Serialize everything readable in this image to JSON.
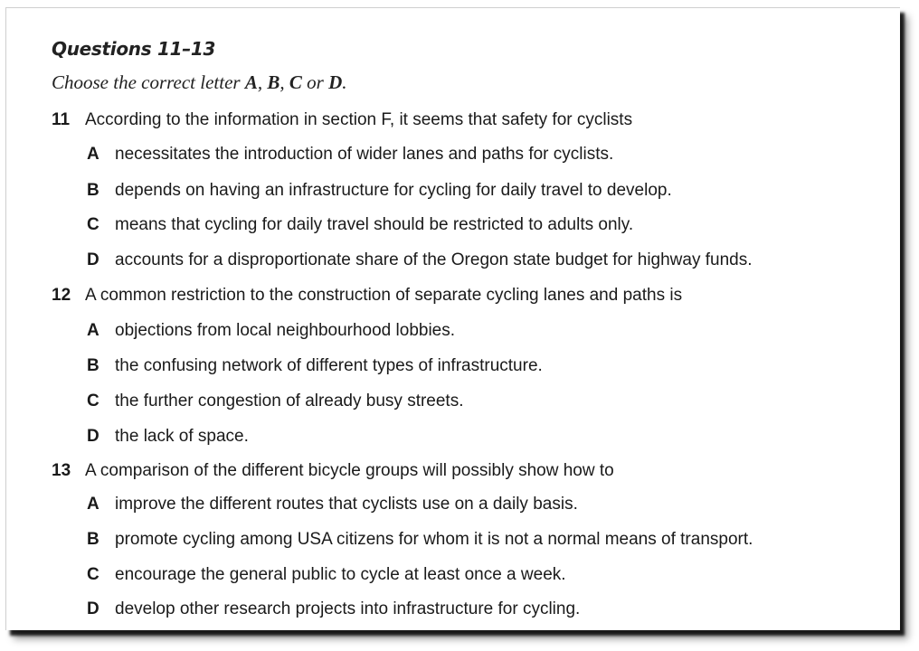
{
  "title": "Questions 11–13",
  "instruction": {
    "prefix": "Choose the correct letter ",
    "letter_a": "A",
    "sep1": ", ",
    "letter_b": "B",
    "sep2": ", ",
    "letter_c": "C",
    "or": " or ",
    "letter_d": "D",
    "suffix": "."
  },
  "questions": [
    {
      "number": "11",
      "text": "According to the information in section F, it seems that safety for cyclists",
      "options": [
        {
          "letter": "A",
          "text": "necessitates the introduction of wider lanes and paths for cyclists."
        },
        {
          "letter": "B",
          "text": "depends on having an infrastructure for cycling for daily travel to develop."
        },
        {
          "letter": "C",
          "text": "means that cycling for daily travel should be restricted to adults only."
        },
        {
          "letter": "D",
          "text": "accounts for a disproportionate share of the Oregon state budget for highway funds."
        }
      ]
    },
    {
      "number": "12",
      "text": "A common restriction to the construction of separate cycling lanes and paths is",
      "options": [
        {
          "letter": "A",
          "text": "objections from local neighbourhood lobbies."
        },
        {
          "letter": "B",
          "text": "the confusing network of different types of infrastructure."
        },
        {
          "letter": "C",
          "text": "the further congestion of already busy streets."
        },
        {
          "letter": "D",
          "text": "the lack of space."
        }
      ]
    },
    {
      "number": "13",
      "text": "A comparison of the different bicycle groups will possibly show how to",
      "options": [
        {
          "letter": "A",
          "text": "improve the different routes that cyclists use on a daily basis."
        },
        {
          "letter": "B",
          "text": "promote cycling among USA citizens for whom it is not a normal means of transport."
        },
        {
          "letter": "C",
          "text": "encourage the general public to cycle at least once a week."
        },
        {
          "letter": "D",
          "text": "develop other research projects into infrastructure for cycling."
        }
      ]
    }
  ]
}
